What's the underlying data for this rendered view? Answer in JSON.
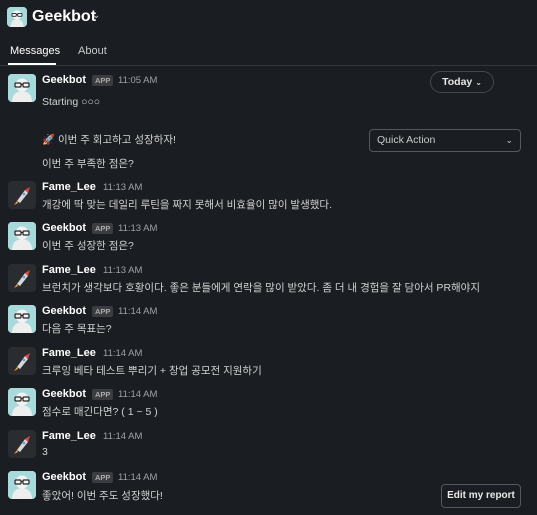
{
  "header": {
    "app_name": "Geekbot",
    "dropdown_icon": "chevron-down-icon"
  },
  "tabs": [
    {
      "label": "Messages",
      "active": true
    },
    {
      "label": "About",
      "active": false
    }
  ],
  "date_pill": {
    "label": "Today",
    "icon": "chevron-down-icon"
  },
  "quick_action": {
    "label": "Quick Action",
    "icon": "chevron-down-icon"
  },
  "edit_button": {
    "label": "Edit my report"
  },
  "badge_label": "APP",
  "messages": [
    {
      "sender": "Geekbot",
      "is_app": true,
      "time": "11:05 AM",
      "lines": [
        "Starting ○○○",
        "🚀 이번 주 회고하고 성장하자!",
        "이번 주 부족한 점은?"
      ]
    },
    {
      "sender": "Fame_Lee",
      "is_app": false,
      "time": "11:13 AM",
      "lines": [
        "개강에 딱 맞는 데일리 루틴을 짜지 못해서 비효율이 많이 발생했다."
      ]
    },
    {
      "sender": "Geekbot",
      "is_app": true,
      "time": "11:13 AM",
      "lines": [
        "이번 주 성장한 점은?"
      ]
    },
    {
      "sender": "Fame_Lee",
      "is_app": false,
      "time": "11:13 AM",
      "lines": [
        "브런치가 생각보다 호황이다. 좋은 분들에게 연락을 많이 받았다. 좀 더 내 경험을 잘 담아서 PR해야지"
      ]
    },
    {
      "sender": "Geekbot",
      "is_app": true,
      "time": "11:14 AM",
      "lines": [
        "다음 주 목표는?"
      ]
    },
    {
      "sender": "Fame_Lee",
      "is_app": false,
      "time": "11:14 AM",
      "lines": [
        "크루잉 베타 테스트 뿌리기 + 창업 공모전 지원하기"
      ]
    },
    {
      "sender": "Geekbot",
      "is_app": true,
      "time": "11:14 AM",
      "lines": [
        "점수로 매긴다면? ( 1 ~ 5 )"
      ]
    },
    {
      "sender": "Fame_Lee",
      "is_app": false,
      "time": "11:14 AM",
      "lines": [
        "3"
      ]
    },
    {
      "sender": "Geekbot",
      "is_app": true,
      "time": "11:14 AM",
      "lines": [
        "좋았어! 이번 주도 성장했다!"
      ]
    }
  ],
  "colors": {
    "background": "#1a1d21",
    "text": "#d1d2d3",
    "bot_avatar_bg": "#a8dadb",
    "divider": "#35373b"
  }
}
